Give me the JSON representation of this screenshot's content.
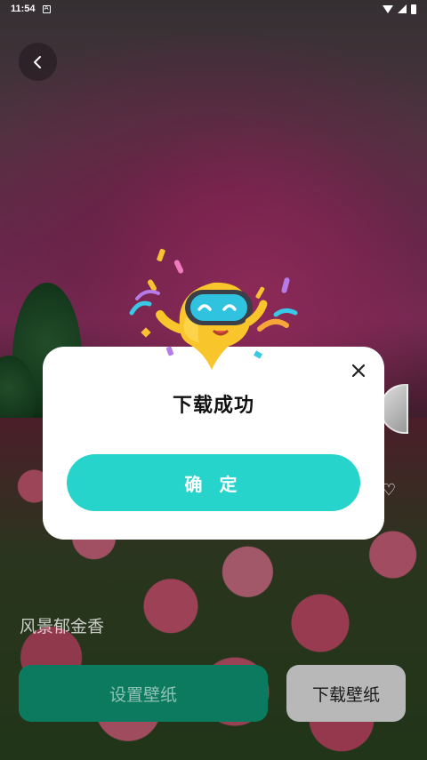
{
  "status_bar": {
    "time": "11:54",
    "notification_icon": "a-icon"
  },
  "back_button": {
    "icon": "chevron-left-icon"
  },
  "wallpaper": {
    "title": "风景郁金香"
  },
  "dialog": {
    "title": "下载成功",
    "confirm_label": "确 定",
    "close_icon": "close-icon",
    "accent_color": "#26d4cc"
  },
  "actions": {
    "set_wallpaper_label": "设置壁纸",
    "download_label": "下载壁纸",
    "set_color": "#0b7a5e"
  }
}
